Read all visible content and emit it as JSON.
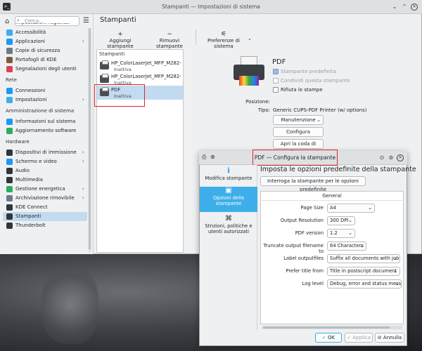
{
  "window": {
    "title": "Stampanti — Impostazioni di sistema",
    "app_icon": "terminal-icon"
  },
  "sidebar": {
    "search_placeholder": "Cerca...",
    "partial_top": "Impostazioni regionali",
    "items_a": [
      {
        "label": "Accessibilità",
        "color": "#3daee9",
        "chev": false
      },
      {
        "label": "Applicazioni",
        "color": "#1d99f3",
        "chev": true
      },
      {
        "label": "Copie di sicurezza",
        "color": "#6c7a89",
        "chev": false
      },
      {
        "label": "Portafogli di KDE",
        "color": "#7b5c3a",
        "chev": false
      },
      {
        "label": "Segnalazioni degli utenti",
        "color": "#da4453",
        "chev": false
      }
    ],
    "section_rete": "Rete",
    "items_b": [
      {
        "label": "Connessioni",
        "color": "#1d99f3",
        "chev": false
      },
      {
        "label": "Impostazioni",
        "color": "#3daee9",
        "chev": true
      }
    ],
    "section_admin": "Amministrazione di sistema",
    "items_c": [
      {
        "label": "Informazioni sul sistema",
        "color": "#1d99f3",
        "chev": false
      },
      {
        "label": "Aggiornamento software",
        "color": "#27ae60",
        "chev": false
      }
    ],
    "section_hw": "Hardware",
    "items_d": [
      {
        "label": "Dispositivi di immissione",
        "color": "#31363b",
        "chev": true
      },
      {
        "label": "Schermo e video",
        "color": "#1d99f3",
        "chev": true
      },
      {
        "label": "Audio",
        "color": "#31363b",
        "chev": false
      },
      {
        "label": "Multimedia",
        "color": "#31363b",
        "chev": false
      },
      {
        "label": "Gestione energetica",
        "color": "#27ae60",
        "chev": true
      },
      {
        "label": "Archiviazione rimovibile",
        "color": "#6c7a89",
        "chev": true
      },
      {
        "label": "KDE Connect",
        "color": "#31363b",
        "chev": false
      },
      {
        "label": "Stampanti",
        "color": "#31363b",
        "chev": false,
        "selected": true
      },
      {
        "label": "Thunderbolt",
        "color": "#31363b",
        "chev": false
      }
    ]
  },
  "page": {
    "title": "Stampanti",
    "toolbar": {
      "add": "Aggiungi stampante",
      "remove": "Rimuovi stampante",
      "prefs": "Preferenze di sistema"
    }
  },
  "printers": {
    "header": "Stampanti",
    "list": [
      {
        "name": "HP_ColorLaserJet_MFP_M282-M2...",
        "status": "Inattiva"
      },
      {
        "name": "HP_ColorLaserJet_MFP_M282-M2...",
        "status": "Inattiva"
      },
      {
        "name": "PDF",
        "status": "Inattiva"
      }
    ]
  },
  "details": {
    "name": "PDF",
    "default_printer": "Stampante predefinita",
    "share_printer": "Condividi questa stampante",
    "reject_jobs": "Rifiuta le stampe",
    "position_label": "Posizione:",
    "type_label": "Tipo:",
    "type_value": "Generic CUPS-PDF Printer (w/ options)",
    "maintenance": "Manutenzione",
    "configure": "Configura",
    "open_queue": "Apri la coda di stampa"
  },
  "dialog": {
    "title": "PDF — Configura la stampante",
    "side": [
      {
        "label": "Modifica stampante",
        "icon": "info-icon"
      },
      {
        "label": "Opzioni della stampante",
        "icon": "printer-options-icon",
        "selected": true
      },
      {
        "label": "Strizioni, politiche e utenti autorizzati",
        "icon": "rss-icon"
      }
    ],
    "heading": "Imposta le opzioni predefinite della stampante",
    "query_button": "Interroga la stampante per le opzioni predefinite",
    "group_title": "General",
    "fields": [
      {
        "label": "Page Size",
        "value": "A4"
      },
      {
        "label": "Output Resolution",
        "value": "300 DPI"
      },
      {
        "label": "PDF version",
        "value": "1.2"
      },
      {
        "label": "Truncate output filename to",
        "value": "64 Characters"
      },
      {
        "label": "Label outputfiles",
        "value": "Suffix all documents with job-id"
      },
      {
        "label": "Prefer title from",
        "value": "Title in postscript document"
      },
      {
        "label": "Log level",
        "value": "Debug, error and status messages"
      }
    ],
    "ok": "OK",
    "apply": "Applica",
    "cancel": "Annulla"
  }
}
